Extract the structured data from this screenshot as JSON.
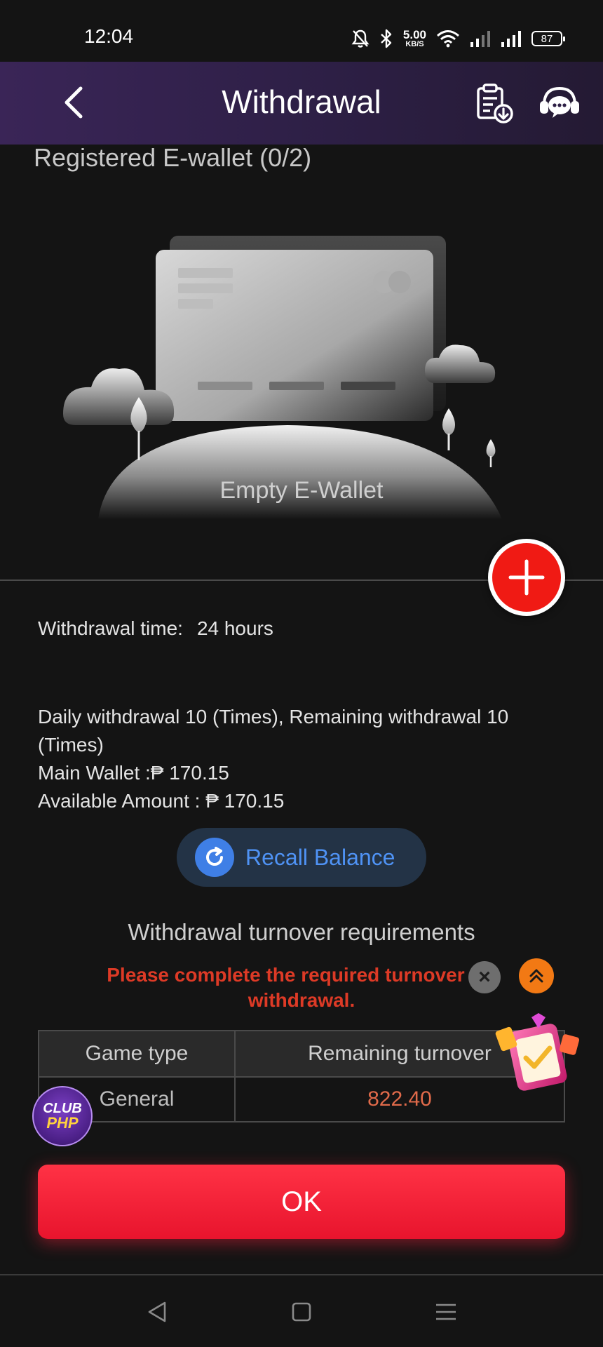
{
  "status_bar": {
    "time": "12:04",
    "net_speed_value": "5.00",
    "net_speed_unit": "KB/S",
    "battery": "87",
    "icons": [
      "mute-bell-icon",
      "bluetooth-icon",
      "wifi-icon",
      "signal-icon",
      "signal-icon",
      "battery-icon"
    ]
  },
  "header": {
    "title": "Withdrawal",
    "back_icon": "chevron-left-icon",
    "history_icon": "clipboard-download-icon",
    "support_icon": "headset-support-icon",
    "gradient_colors": [
      "#3a2557",
      "#241a33"
    ]
  },
  "wallet": {
    "section_label": "Registered E-wallet (0/2)",
    "empty_text": "Empty E-Wallet",
    "add_icon": "plus-icon",
    "add_color": "#f01a14"
  },
  "info": {
    "withdrawal_time_label": "Withdrawal time:",
    "withdrawal_time_value": "24 hours",
    "daily_text": "Daily withdrawal 10 (Times), Remaining withdrawal 10 (Times)",
    "main_wallet": "Main Wallet :₱ 170.15",
    "available_amount": "Available Amount : ₱ 170.15"
  },
  "recall": {
    "label": "Recall Balance",
    "icon": "refresh-icon",
    "color": "#4f93f5"
  },
  "turnover": {
    "title": "Withdrawal turnover requirements",
    "warning": "Please complete the required turnover for withdrawal.",
    "warning_color": "#dd3a26",
    "columns": [
      "Game type",
      "Remaining turnover"
    ],
    "rows": [
      {
        "game_type": "General",
        "remaining": "822.40"
      }
    ]
  },
  "floating": {
    "close_symbol": "×",
    "scroll_top_icon": "double-chevron-up-icon",
    "task_icon": "task-clipboard-icon",
    "club_line1": "CLUB",
    "club_line2": "PHP"
  },
  "ok_button": {
    "label": "OK",
    "color": "#ff3245"
  },
  "nav": {
    "back_icon": "triangle-back-icon",
    "home_icon": "square-home-icon",
    "menu_icon": "hamburger-menu-icon"
  }
}
